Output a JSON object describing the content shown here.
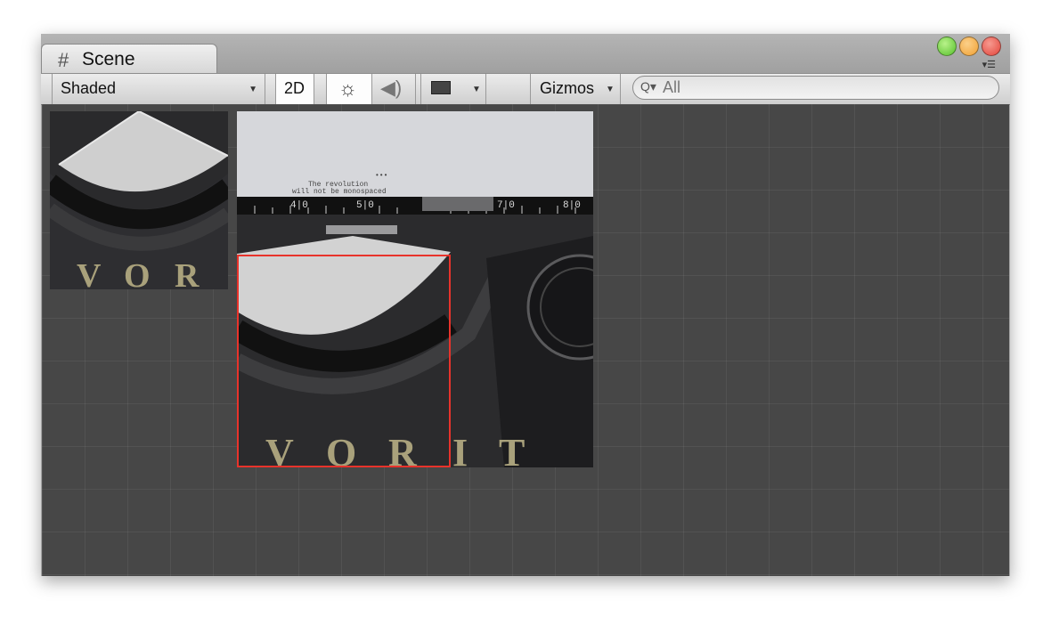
{
  "window": {
    "tab_label": "Scene",
    "traffic_light_colors": [
      "#56c02c",
      "#f0a032",
      "#e2453a"
    ]
  },
  "toolbar": {
    "shading_mode": "Shaded",
    "mode_2d_label": "2D",
    "gizmos_label": "Gizmos",
    "search_placeholder": "All",
    "icons": [
      "sun-icon",
      "speaker-icon",
      "image-icon"
    ]
  },
  "scene": {
    "background_color": "#474747",
    "selection_color": "#e8332b",
    "typewriter_paper_text": [
      "The revolution",
      "will not be monospaced"
    ],
    "ruler_labels": [
      "4|0",
      "5|0",
      "7|0",
      "8|0"
    ],
    "keyboard_letters_full": [
      "V",
      "O",
      "R",
      "I",
      "T"
    ],
    "keyboard_letters_crop": [
      "V",
      "O",
      "R"
    ]
  }
}
